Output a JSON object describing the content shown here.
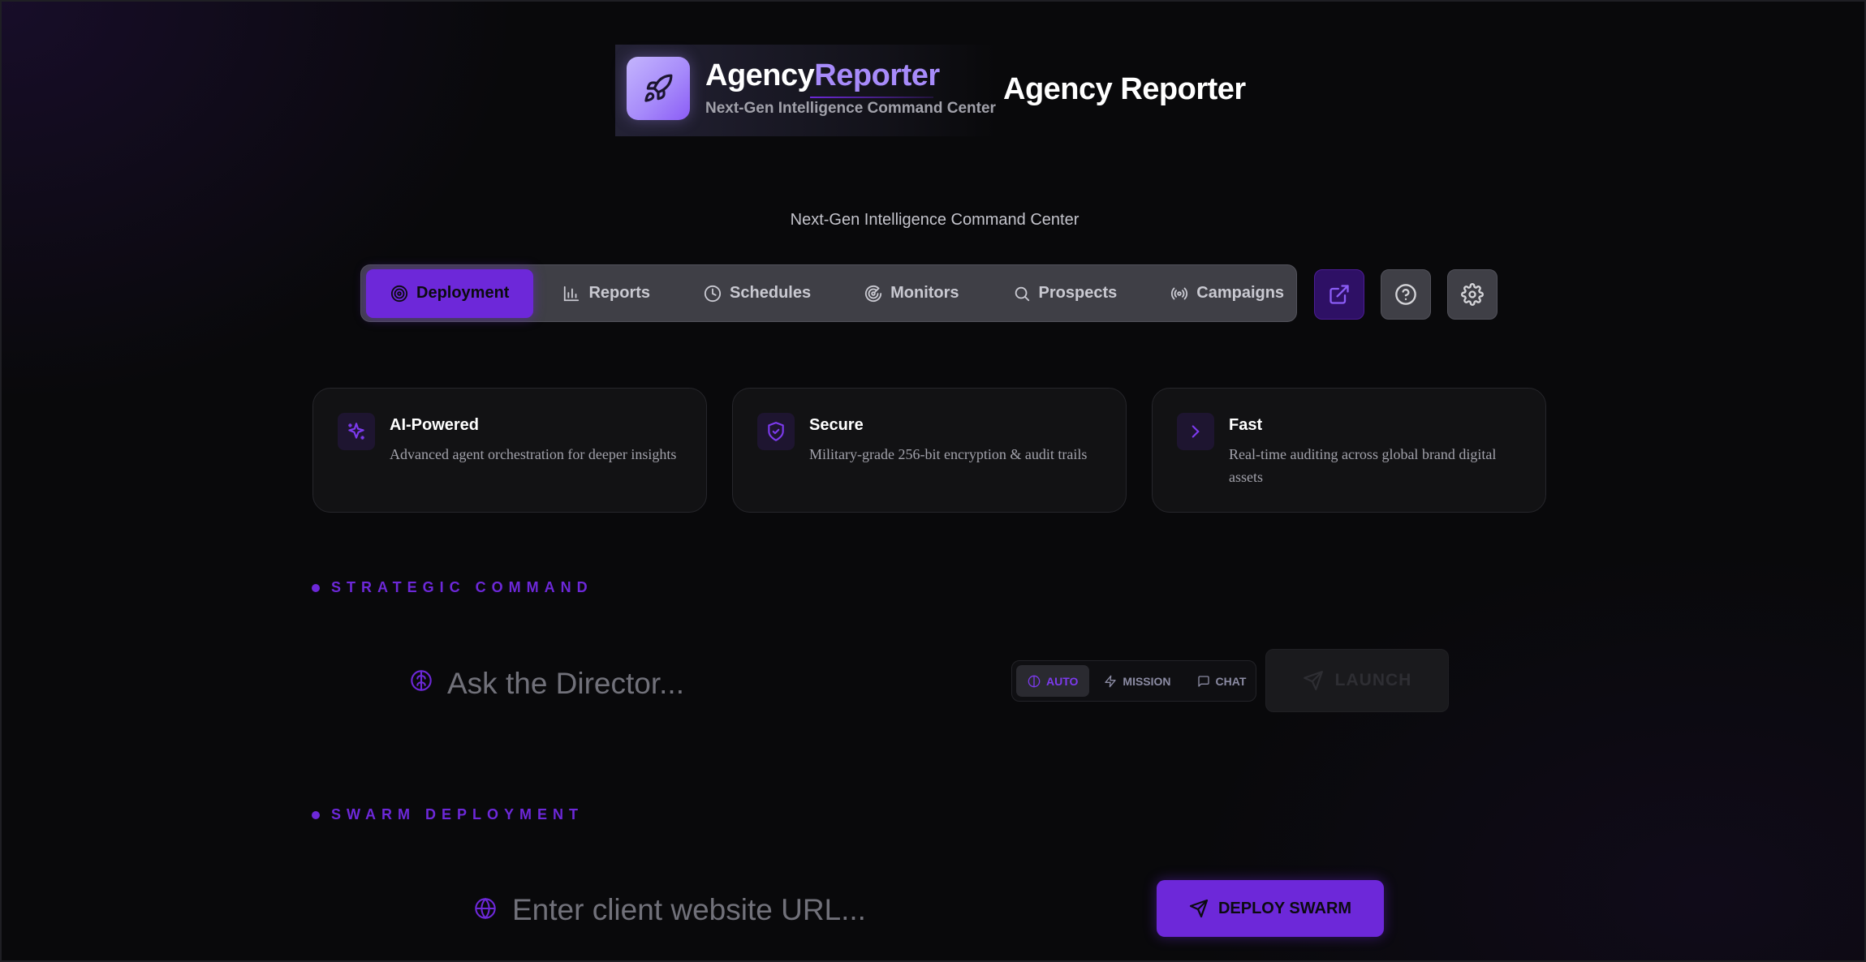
{
  "brand": {
    "name_part1": "Agency",
    "name_part2": "Reporter",
    "tagline": "Next-Gen Intelligence Command Center"
  },
  "header": {
    "title": "Agency Reporter",
    "subtitle": "Next-Gen Intelligence Command Center"
  },
  "nav": {
    "tabs": [
      {
        "label": "Deployment",
        "icon": "target-icon",
        "active": true
      },
      {
        "label": "Reports",
        "icon": "bar-chart-icon",
        "active": false
      },
      {
        "label": "Schedules",
        "icon": "clock-icon",
        "active": false
      },
      {
        "label": "Monitors",
        "icon": "radar-icon",
        "active": false
      },
      {
        "label": "Prospects",
        "icon": "search-icon",
        "active": false
      },
      {
        "label": "Campaigns",
        "icon": "broadcast-icon",
        "active": false
      }
    ],
    "actions": [
      "external-link-icon",
      "help-icon",
      "gear-icon"
    ]
  },
  "features": [
    {
      "title": "AI-Powered",
      "desc": "Advanced agent orchestration for deeper insights",
      "icon": "sparkles-icon"
    },
    {
      "title": "Secure",
      "desc": "Military-grade 256-bit encryption & audit trails",
      "icon": "shield-icon"
    },
    {
      "title": "Fast",
      "desc": "Real-time auditing across global brand digital assets",
      "icon": "chevron-right-icon"
    }
  ],
  "strategic": {
    "label": "STRATEGIC COMMAND",
    "placeholder": "Ask the Director...",
    "modes": [
      {
        "label": "AUTO",
        "active": true
      },
      {
        "label": "MISSION",
        "active": false
      },
      {
        "label": "CHAT",
        "active": false
      }
    ],
    "launch_label": "LAUNCH"
  },
  "swarm": {
    "label": "SWARM DEPLOYMENT",
    "placeholder": "Enter client website URL...",
    "deploy_label": "DEPLOY SWARM"
  },
  "colors": {
    "accent": "#6d28d9",
    "accent_light": "#a78bfa",
    "background": "#09090b"
  }
}
